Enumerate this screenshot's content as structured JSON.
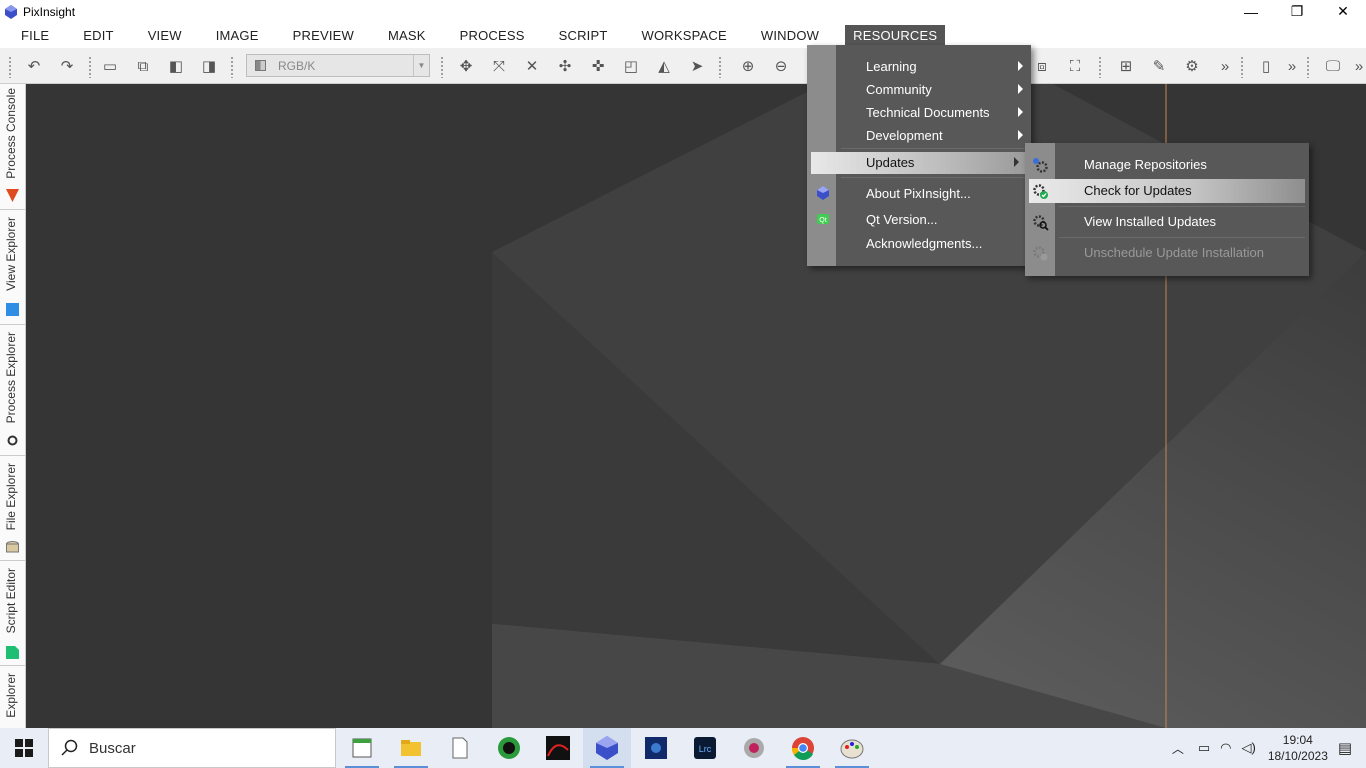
{
  "window": {
    "title": "PixInsight",
    "minimize": "—",
    "restore": "❐",
    "close": "✕"
  },
  "menubar": {
    "items": [
      "FILE",
      "EDIT",
      "VIEW",
      "IMAGE",
      "PREVIEW",
      "MASK",
      "PROCESS",
      "SCRIPT",
      "WORKSPACE",
      "WINDOW",
      "RESOURCES"
    ],
    "active": "RESOURCES"
  },
  "toolbar": {
    "color_space": "RGB/K",
    "overflow_1": "»",
    "overflow_2": "»",
    "overflow_3": "»"
  },
  "sidebar": {
    "tabs": [
      "Process Console",
      "View Explorer",
      "Process Explorer",
      "File Explorer",
      "Script Editor",
      "Explorer"
    ]
  },
  "resources_menu": {
    "items": [
      {
        "label": "Learning",
        "submenu": true
      },
      {
        "label": "Community",
        "submenu": true
      },
      {
        "label": "Technical Documents",
        "submenu": true
      },
      {
        "label": "Development",
        "submenu": true
      },
      {
        "label": "Updates",
        "submenu": true,
        "highlighted": true
      },
      {
        "label": "About PixInsight..."
      },
      {
        "label": "Qt Version..."
      },
      {
        "label": "Acknowledgments..."
      }
    ]
  },
  "updates_submenu": {
    "items": [
      {
        "label": "Manage Repositories"
      },
      {
        "label": "Check for Updates",
        "highlighted": true
      },
      {
        "label": "View Installed Updates"
      },
      {
        "label": "Unschedule Update Installation",
        "disabled": true
      }
    ]
  },
  "taskbar": {
    "search_placeholder": "Buscar",
    "time": "19:04",
    "date": "18/10/2023"
  },
  "colors": {
    "menu_bg": "#585858",
    "highlight": "#e8e8e8",
    "workspace": "#3a3a3a",
    "accent_line": "#c8854f"
  }
}
